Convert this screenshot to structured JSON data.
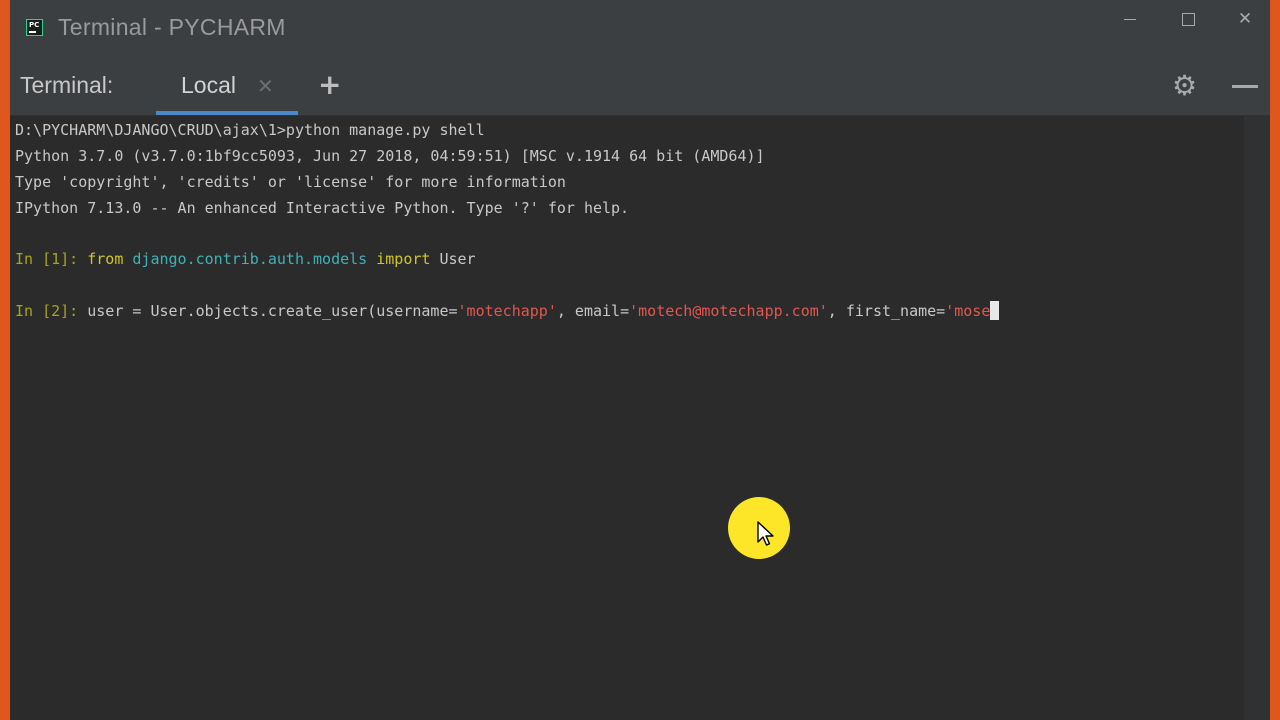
{
  "window": {
    "title": "Terminal - PYCHARM",
    "controls": {
      "minimize_icon": "minimize-icon",
      "maximize_icon": "maximize-icon",
      "close_glyph": "✕"
    }
  },
  "toolbar": {
    "label": "Terminal:",
    "tabs": [
      {
        "label": "Local",
        "close_glyph": "✕",
        "active": true
      }
    ],
    "add_glyph": "+",
    "settings_glyph": "⚙",
    "settings_icon": "gear-icon",
    "hide_icon": "minimize-panel-icon"
  },
  "terminal": {
    "lines": {
      "l1": "D:\\PYCHARM\\DJANGO\\CRUD\\ajax\\1>python manage.py shell",
      "l2": "Python 3.7.0 (v3.7.0:1bf9cc5093, Jun 27 2018, 04:59:51) [MSC v.1914 64 bit (AMD64)]",
      "l3": "Type 'copyright', 'credits' or 'license' for more information",
      "l4": "IPython 7.13.0 -- An enhanced Interactive Python. Type '?' for help."
    },
    "in1": {
      "prompt": "In [1]: ",
      "kw_from": "from",
      "module": "django.contrib.auth.models",
      "kw_import": "import",
      "name": "User"
    },
    "in2": {
      "prompt": "In [2]: ",
      "code1": "user = User.objects.create_user(username=",
      "str1": "'motechapp'",
      "code2": ", email=",
      "str2": "'motech@motechapp.com'",
      "code3": ", first_name=",
      "str3": "'mose"
    }
  },
  "colors": {
    "background": "#2b2b2b",
    "prompt": "#a5a51b",
    "keyword": "#cfc42a",
    "module": "#3fb2b7",
    "string": "#e0584f",
    "tab_underline": "#4a88c7",
    "frame": "#e0571e",
    "mouse_highlight": "#fde627"
  }
}
